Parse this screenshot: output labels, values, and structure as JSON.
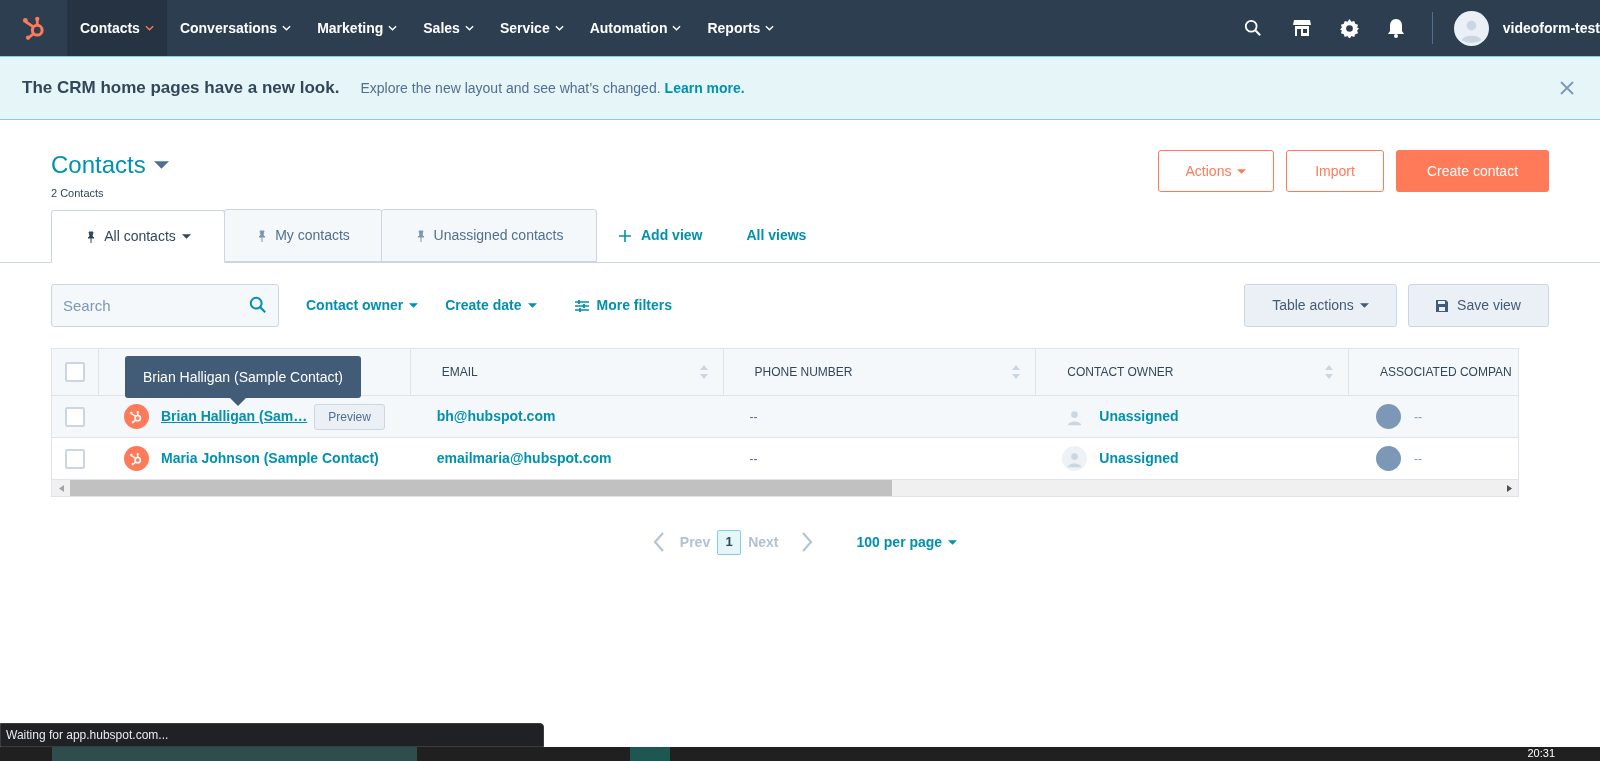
{
  "nav": {
    "items": [
      {
        "label": "Contacts",
        "selected": true
      },
      {
        "label": "Conversations",
        "selected": false
      },
      {
        "label": "Marketing",
        "selected": false
      },
      {
        "label": "Sales",
        "selected": false
      },
      {
        "label": "Service",
        "selected": false
      },
      {
        "label": "Automation",
        "selected": false
      },
      {
        "label": "Reports",
        "selected": false
      }
    ],
    "account": "videoform-test"
  },
  "banner": {
    "title": "The CRM home pages have a new look.",
    "text": "Explore the new layout and see what’s changed.",
    "link": "Learn more."
  },
  "header": {
    "title": "Contacts",
    "count": "2 Contacts",
    "buttons": [
      {
        "label": "Actions",
        "kind": "dropdown"
      },
      {
        "label": "Import",
        "kind": "outline"
      },
      {
        "label": "Create contact",
        "kind": "primary"
      }
    ]
  },
  "views": {
    "tabs": [
      {
        "label": "All contacts",
        "selected": true
      },
      {
        "label": "My contacts",
        "selected": false
      },
      {
        "label": "Unassigned contacts",
        "selected": false
      }
    ],
    "add_view": "Add view",
    "all_views": "All views"
  },
  "filters": {
    "search_placeholder": "Search",
    "dropdowns": [
      "Contact owner",
      "Create date"
    ],
    "more_filters": "More filters",
    "table_actions": "Table actions",
    "save_view": "Save view"
  },
  "table": {
    "all_checked": false,
    "tooltip": "Brian Halligan (Sample Contact)",
    "columns": [
      {
        "label": "EMAIL",
        "sortable": true
      },
      {
        "label": "PHONE NUMBER",
        "sortable": true
      },
      {
        "label": "CONTACT OWNER",
        "sortable": true
      },
      {
        "label": "ASSOCIATED COMPAN",
        "sortable": false
      }
    ],
    "rows": [
      {
        "checked": false,
        "hovered": true,
        "name": "Brian Halligan (Sam…",
        "preview": "Preview",
        "email": "bh@hubspot.com",
        "phone": "--",
        "owner": "Unassigned",
        "company": "--"
      },
      {
        "checked": false,
        "hovered": false,
        "name": "Maria Johnson (Sample Contact)",
        "email": "emailmaria@hubspot.com",
        "phone": "--",
        "owner": "Unassigned",
        "company": "--"
      }
    ]
  },
  "pagination": {
    "prev": "Prev",
    "page": "1",
    "next": "Next",
    "per_page": "100 per page"
  },
  "status": {
    "text": "Waiting for app.hubspot.com...",
    "clock": "20:31"
  }
}
